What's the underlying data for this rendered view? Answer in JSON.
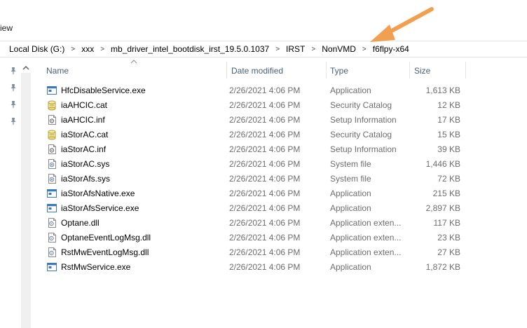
{
  "ribbon": {
    "view_tab": "iew"
  },
  "breadcrumb": [
    "Local Disk (G:)",
    "xxx",
    "mb_driver_intel_bootdisk_irst_19.5.0.1037",
    "IRST",
    "NonVMD",
    "f6flpy-x64"
  ],
  "columns": {
    "name": "Name",
    "date": "Date modified",
    "type": "Type",
    "size": "Size"
  },
  "files": [
    {
      "name": "HfcDisableService.exe",
      "date": "2/26/2021 4:06 PM",
      "type": "Application",
      "size": "1,613 KB",
      "icon": "application-icon"
    },
    {
      "name": "iaAHCIC.cat",
      "date": "2/26/2021 4:06 PM",
      "type": "Security Catalog",
      "size": "12 KB",
      "icon": "security-catalog-icon"
    },
    {
      "name": "iaAHCIC.inf",
      "date": "2/26/2021 4:06 PM",
      "type": "Setup Information",
      "size": "17 KB",
      "icon": "setup-information-icon"
    },
    {
      "name": "iaStorAC.cat",
      "date": "2/26/2021 4:06 PM",
      "type": "Security Catalog",
      "size": "15 KB",
      "icon": "security-catalog-icon"
    },
    {
      "name": "iaStorAC.inf",
      "date": "2/26/2021 4:06 PM",
      "type": "Setup Information",
      "size": "39 KB",
      "icon": "setup-information-icon"
    },
    {
      "name": "iaStorAC.sys",
      "date": "2/26/2021 4:06 PM",
      "type": "System file",
      "size": "1,446 KB",
      "icon": "system-file-icon"
    },
    {
      "name": "iaStorAfs.sys",
      "date": "2/26/2021 4:06 PM",
      "type": "System file",
      "size": "72 KB",
      "icon": "system-file-icon"
    },
    {
      "name": "iaStorAfsNative.exe",
      "date": "2/26/2021 4:06 PM",
      "type": "Application",
      "size": "215 KB",
      "icon": "application-icon"
    },
    {
      "name": "iaStorAfsService.exe",
      "date": "2/26/2021 4:06 PM",
      "type": "Application",
      "size": "2,897 KB",
      "icon": "application-icon"
    },
    {
      "name": "Optane.dll",
      "date": "2/26/2021 4:06 PM",
      "type": "Application exten...",
      "size": "117 KB",
      "icon": "application-extension-icon"
    },
    {
      "name": "OptaneEventLogMsg.dll",
      "date": "2/26/2021 4:06 PM",
      "type": "Application exten...",
      "size": "23 KB",
      "icon": "application-extension-icon"
    },
    {
      "name": "RstMwEventLogMsg.dll",
      "date": "2/26/2021 4:06 PM",
      "type": "Application exten...",
      "size": "27 KB",
      "icon": "application-extension-icon"
    },
    {
      "name": "RstMwService.exe",
      "date": "2/26/2021 4:06 PM",
      "type": "Application",
      "size": "1,872 KB",
      "icon": "application-icon"
    }
  ],
  "colors": {
    "header_text": "#4c607a",
    "meta_text": "#6d6d6d",
    "annotation_arrow": "#f0a050"
  }
}
